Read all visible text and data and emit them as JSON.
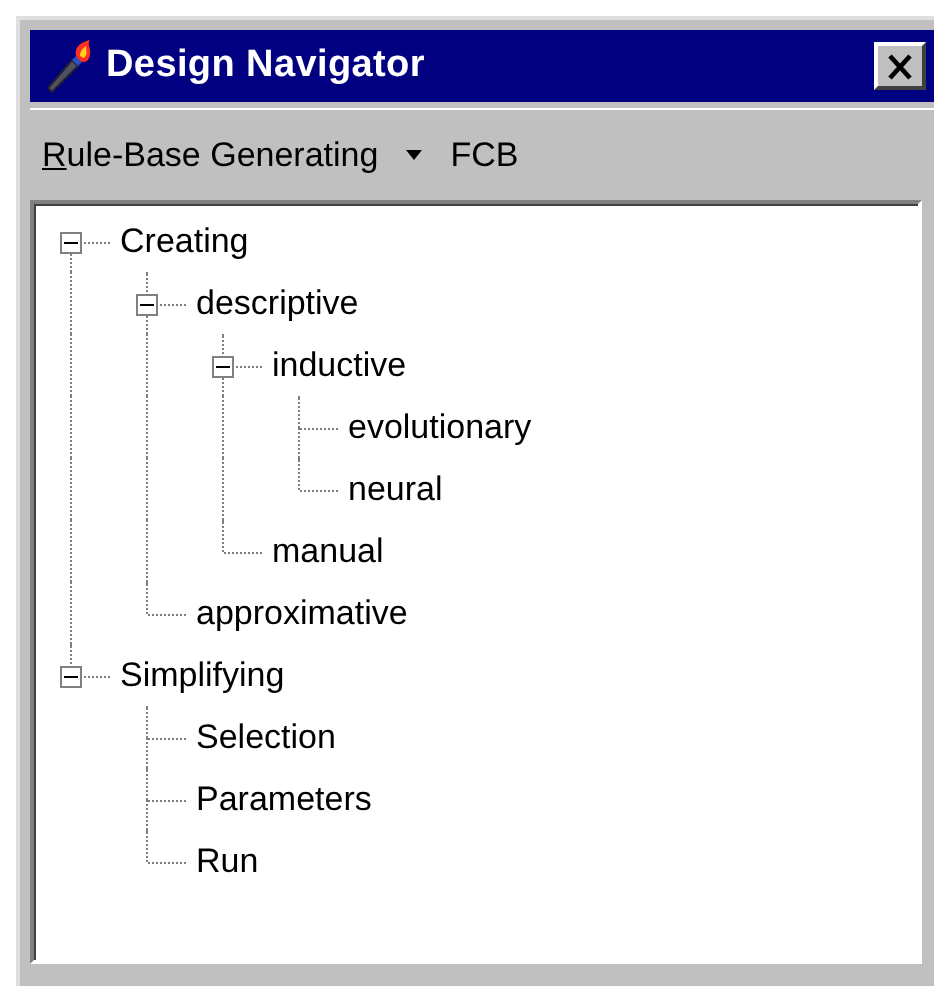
{
  "window": {
    "title": "Design Navigator"
  },
  "toolbar": {
    "menu": {
      "access_key": "R",
      "label": "ule-Base Generating"
    },
    "text": "FCB"
  },
  "tree": [
    {
      "label": "Creating",
      "expanded": true,
      "children": [
        {
          "label": "descriptive",
          "expanded": true,
          "children": [
            {
              "label": "inductive",
              "expanded": true,
              "children": [
                {
                  "label": "evolutionary"
                },
                {
                  "label": "neural"
                }
              ]
            },
            {
              "label": "manual"
            }
          ]
        },
        {
          "label": "approximative"
        }
      ]
    },
    {
      "label": "Simplifying",
      "expanded": true,
      "children": [
        {
          "label": "Selection"
        },
        {
          "label": "Parameters"
        },
        {
          "label": "Run"
        }
      ]
    }
  ]
}
